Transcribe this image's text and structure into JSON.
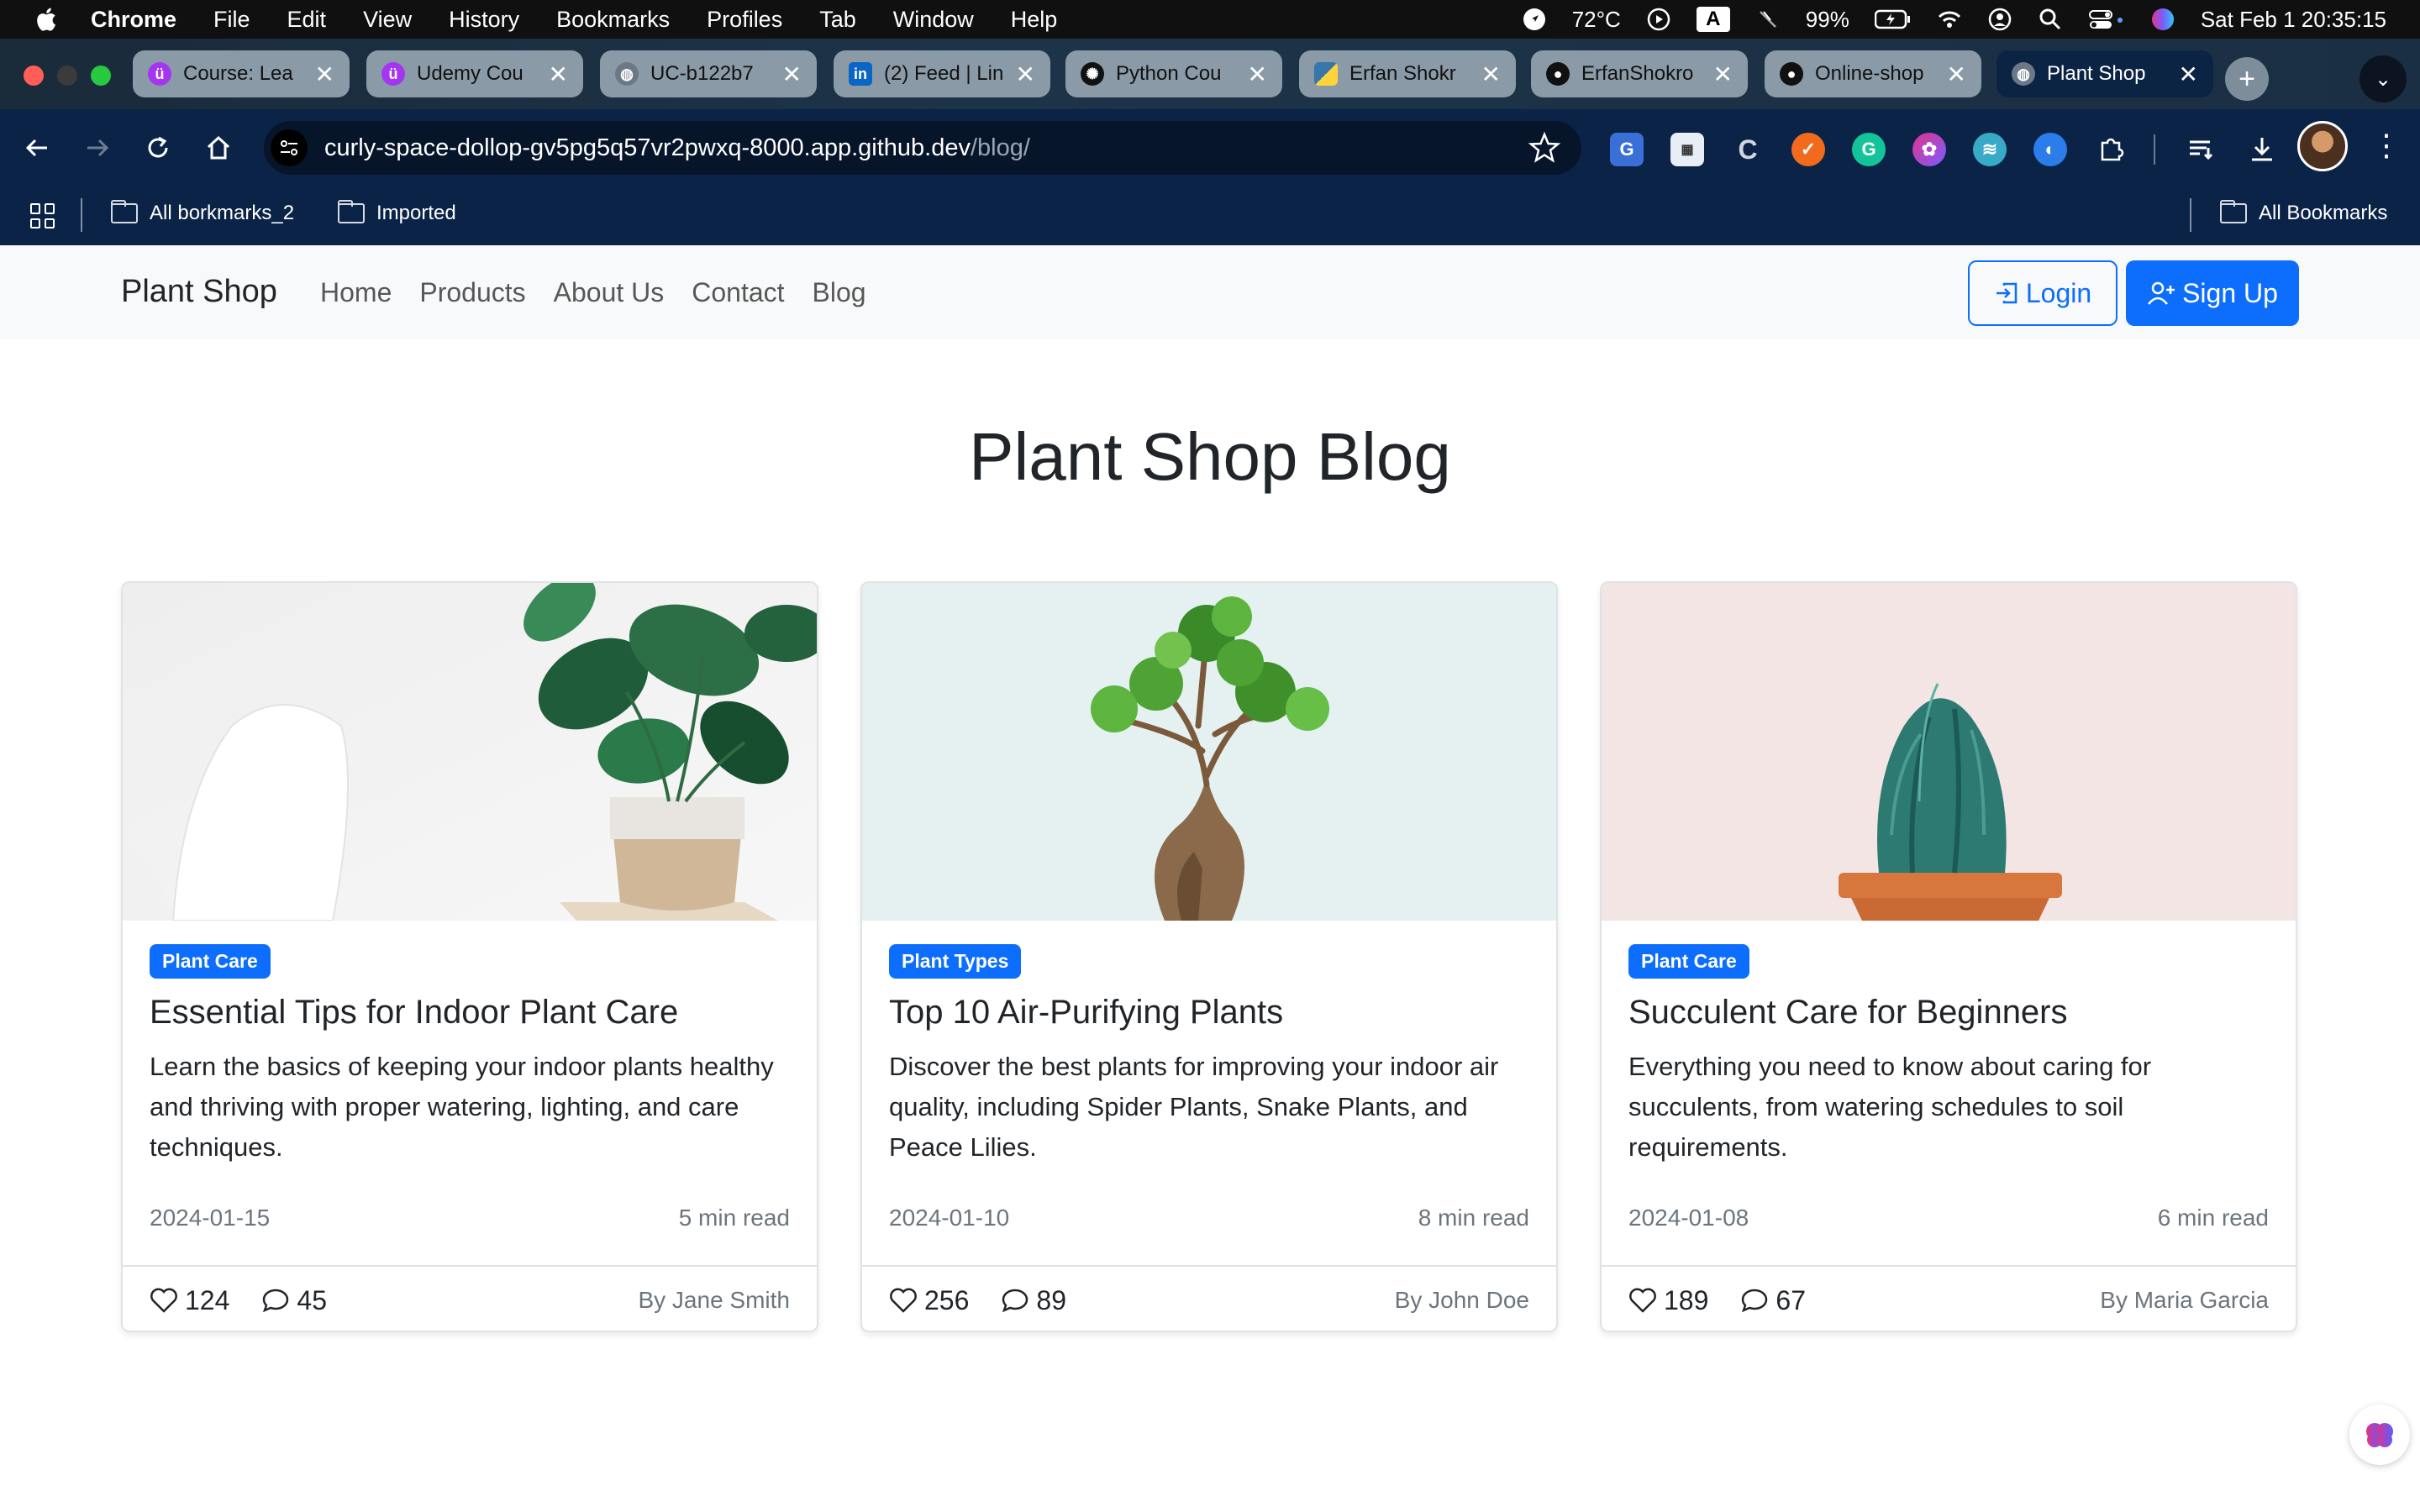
{
  "menubar": {
    "app": "Chrome",
    "menus": [
      "File",
      "Edit",
      "View",
      "History",
      "Bookmarks",
      "Profiles",
      "Tab",
      "Window",
      "Help"
    ],
    "temperature": "72°C",
    "battery": "99%",
    "datetime": "Sat Feb 1  20:35:15"
  },
  "tabs": [
    {
      "label": "Course: Lea",
      "favicon": "udemy-icon",
      "color": "#a435f0"
    },
    {
      "label": "Udemy Cou",
      "favicon": "udemy-icon",
      "color": "#a435f0"
    },
    {
      "label": "UC-b122b7",
      "favicon": "globe-icon",
      "color": "#6b7886"
    },
    {
      "label": "(2) Feed | Lin",
      "favicon": "linkedin-icon",
      "color": "#0a66c2"
    },
    {
      "label": "Python Cou",
      "favicon": "openai-icon",
      "color": "#111111"
    },
    {
      "label": "Erfan Shokr",
      "favicon": "python-icon",
      "color": "#3776ab"
    },
    {
      "label": "ErfanShokro",
      "favicon": "github-icon",
      "color": "#111111"
    },
    {
      "label": "Online-shop",
      "favicon": "github-icon",
      "color": "#111111"
    },
    {
      "label": "Plant Shop",
      "favicon": "globe-icon",
      "color": "#6b7886",
      "active": true
    }
  ],
  "address": {
    "host": "curly-space-dollop-gv5pg5q57vr2pwxq-8000.app.github.dev",
    "path": "/blog/"
  },
  "bookmarks": {
    "items": [
      "All borkmarks_2",
      "Imported"
    ],
    "right": "All Bookmarks"
  },
  "site": {
    "brand": "Plant Shop",
    "nav": [
      "Home",
      "Products",
      "About Us",
      "Contact",
      "Blog"
    ],
    "login": "Login",
    "signup": "Sign Up"
  },
  "page": {
    "title": "Plant Shop Blog"
  },
  "posts": [
    {
      "category": "Plant Care",
      "title": "Essential Tips for Indoor Plant Care",
      "description": "Learn the basics of keeping your indoor plants healthy and thriving with proper watering, lighting, and care techniques.",
      "date": "2024-01-15",
      "read_time": "5 min read",
      "likes": "124",
      "comments": "45",
      "author": "By Jane Smith"
    },
    {
      "category": "Plant Types",
      "title": "Top 10 Air-Purifying Plants",
      "description": "Discover the best plants for improving your indoor air quality, including Spider Plants, Snake Plants, and Peace Lilies.",
      "date": "2024-01-10",
      "read_time": "8 min read",
      "likes": "256",
      "comments": "89",
      "author": "By John Doe"
    },
    {
      "category": "Plant Care",
      "title": "Succulent Care for Beginners",
      "description": "Everything you need to know about caring for succulents, from watering schedules to soil requirements.",
      "date": "2024-01-08",
      "read_time": "6 min read",
      "likes": "189",
      "comments": "67",
      "author": "By Maria Garcia"
    }
  ],
  "colors": {
    "primary": "#0d6efd",
    "navbar_bg": "#f8f9fa",
    "chrome_toolbar": "#0b2347"
  }
}
